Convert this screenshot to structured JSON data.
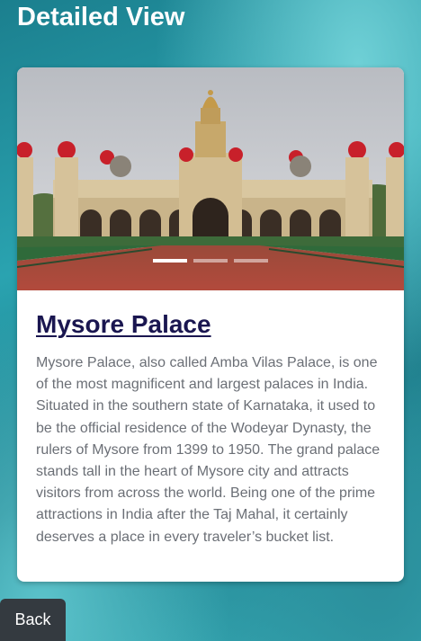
{
  "page": {
    "title": "Detailed View"
  },
  "carousel": {
    "slide_count": 3,
    "active_index": 0,
    "image_alt": "Mysore Palace"
  },
  "place": {
    "title": "Mysore Palace",
    "description": "Mysore Palace, also called Amba Vilas Palace, is one of the most magnificent and largest palaces in India. Situated in the southern state of Karnataka, it used to be the official residence of the Wodeyar Dynasty, the rulers of Mysore from 1399 to 1950. The grand palace stands tall in the heart of Mysore city and attracts visitors from across the world. Being one of the prime attractions in India after the Taj Mahal, it certainly deserves a place in every traveler’s bucket list."
  },
  "back": {
    "label": "Back"
  },
  "colors": {
    "title_text": "#1a1650",
    "back_button": "#343a40",
    "background": "#2aa3b0"
  }
}
